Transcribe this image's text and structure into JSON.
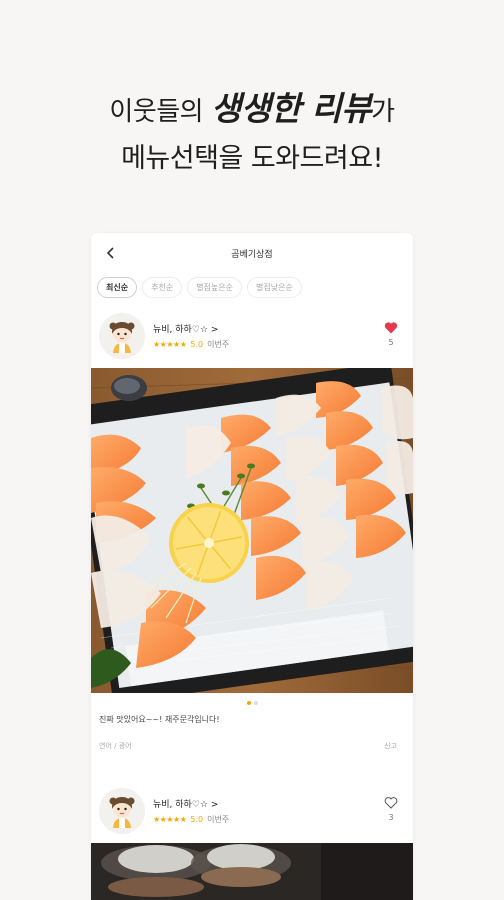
{
  "hero": {
    "line1_pre": "이웃들의 ",
    "line1_emph": "생생한 리뷰",
    "line1_post": "가",
    "line2": "메뉴선택을 도와드려요!"
  },
  "screen": {
    "title": "곰베기상점",
    "back_icon": "chevron-left-icon",
    "sort_tabs": [
      "최신순",
      "추천순",
      "별점높은순",
      "별점낮은순"
    ],
    "active_sort": "최신순"
  },
  "reviews": [
    {
      "username": "뉴비, 하하♡☆ >",
      "stars": "★★★★★",
      "score": "5.0",
      "date": "이번주",
      "liked": true,
      "like_count": "5",
      "text": "진짜 맛있어요~~! 재주문각입니다!",
      "tag": "연어 / 광어",
      "report_label": "신고",
      "photo_index": "1/2"
    },
    {
      "username": "뉴비, 하하♡☆ >",
      "stars": "★★★★★",
      "score": "5.0",
      "date": "이번주",
      "liked": false,
      "like_count": "3"
    }
  ],
  "colors": {
    "star": "#f5a800",
    "heart_active": "#e53950",
    "background": "#f7f6f4"
  }
}
